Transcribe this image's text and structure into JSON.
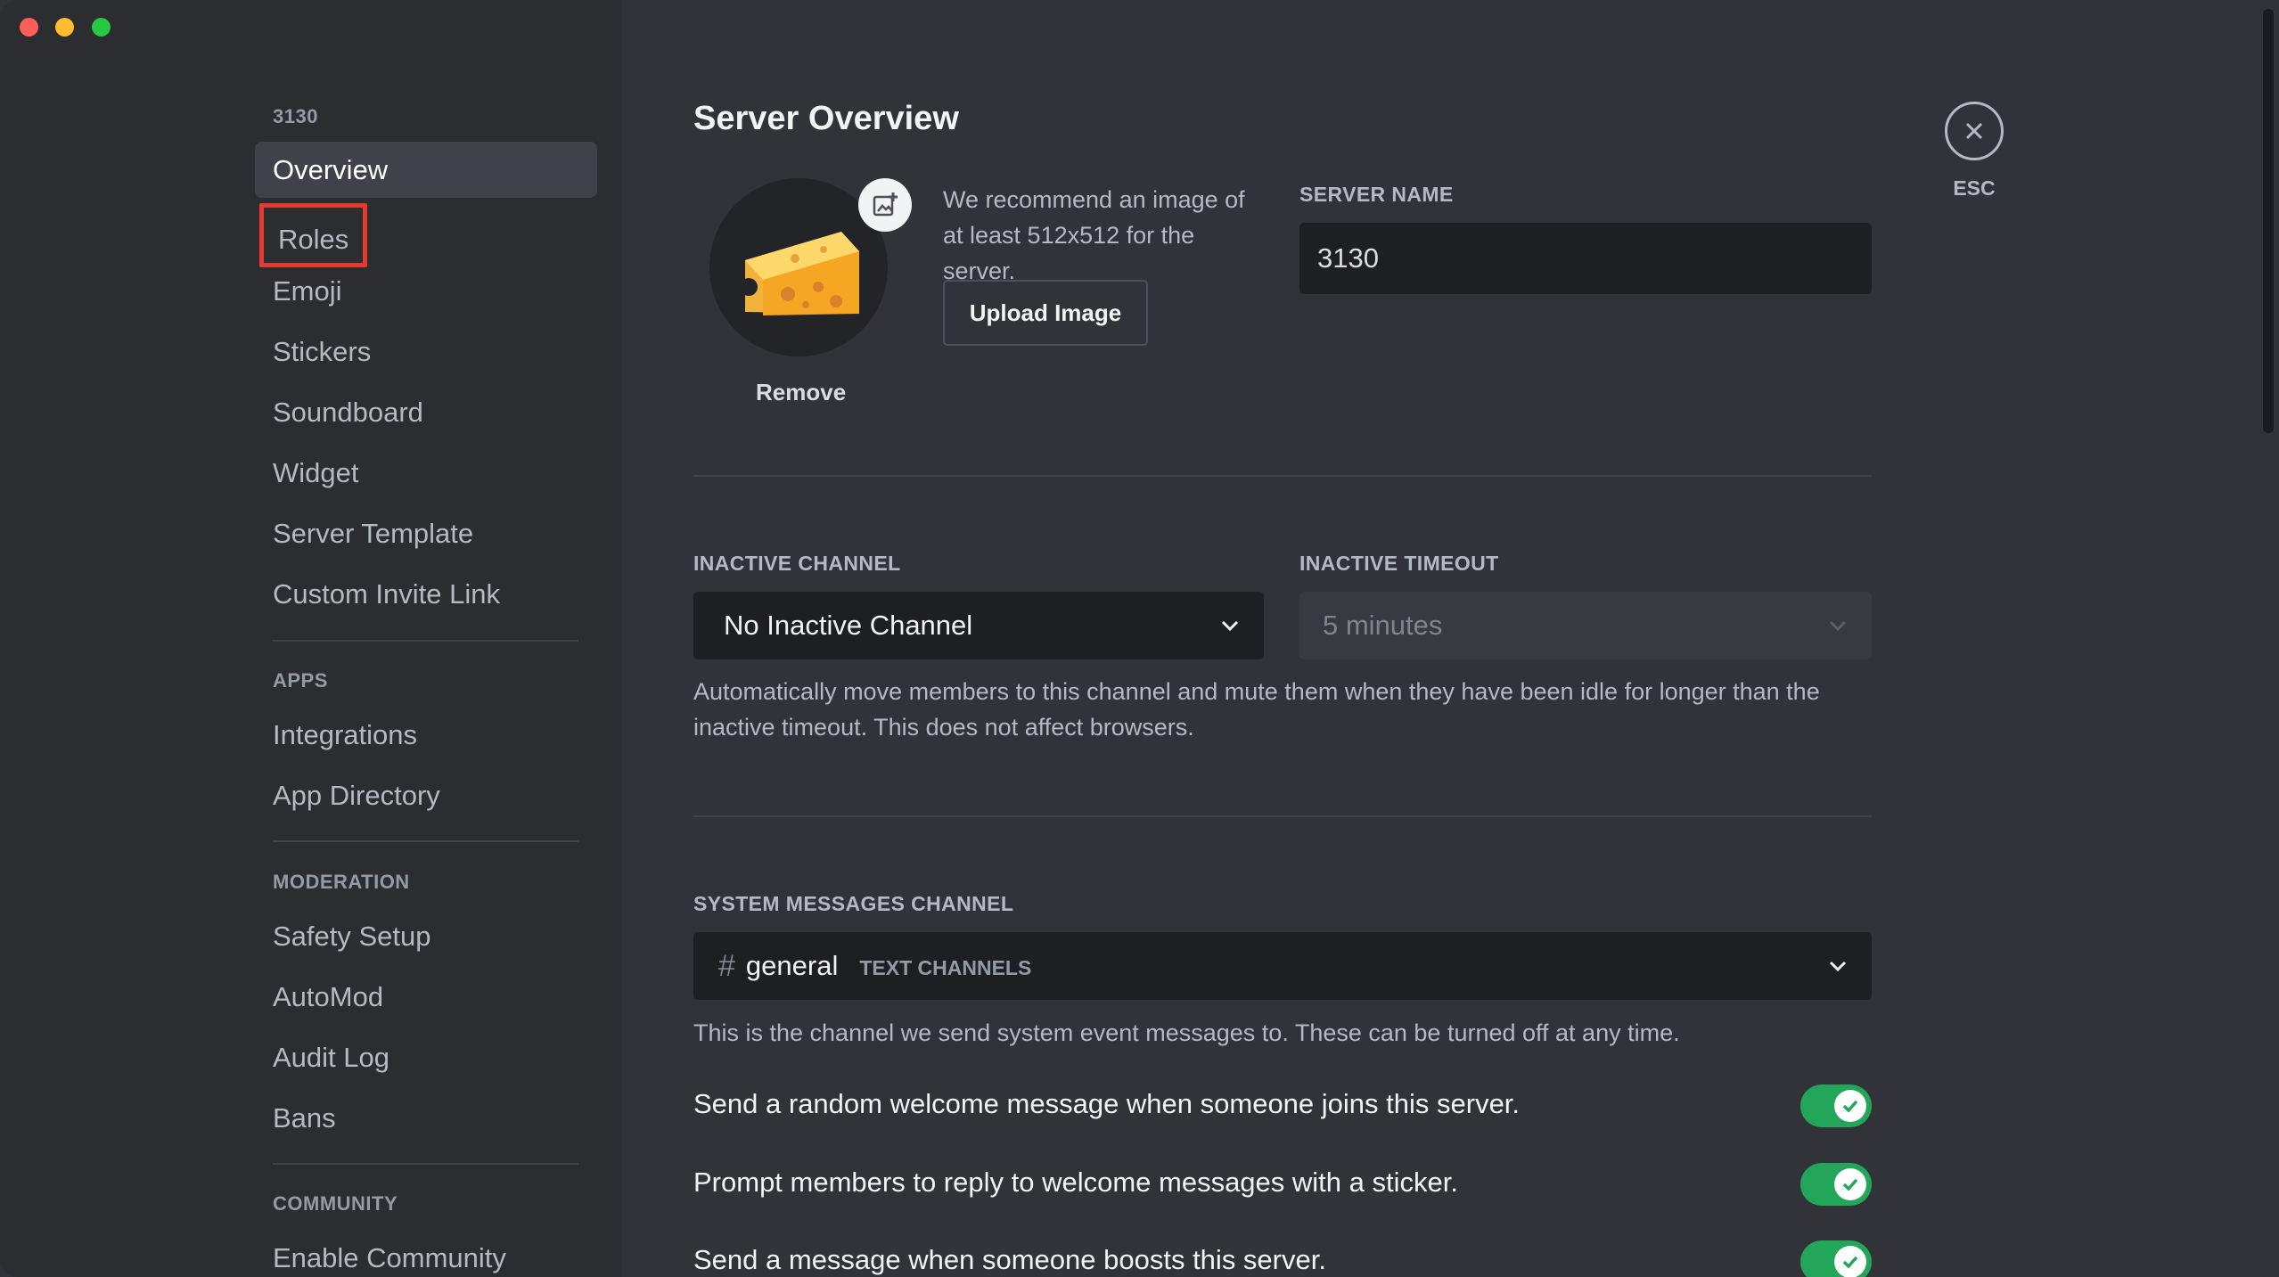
{
  "window": {
    "controls": [
      "close",
      "minimize",
      "maximize"
    ]
  },
  "sidebar": {
    "server_header": "3130",
    "items_main": [
      {
        "label": "Overview",
        "active": true
      },
      {
        "label": "Roles",
        "highlighted": true
      },
      {
        "label": "Emoji"
      },
      {
        "label": "Stickers"
      },
      {
        "label": "Soundboard"
      },
      {
        "label": "Widget"
      },
      {
        "label": "Server Template"
      },
      {
        "label": "Custom Invite Link"
      }
    ],
    "apps_header": "Apps",
    "items_apps": [
      {
        "label": "Integrations"
      },
      {
        "label": "App Directory"
      }
    ],
    "moderation_header": "Moderation",
    "items_moderation": [
      {
        "label": "Safety Setup"
      },
      {
        "label": "AutoMod"
      },
      {
        "label": "Audit Log"
      },
      {
        "label": "Bans"
      }
    ],
    "community_header": "Community",
    "items_community": [
      {
        "label": "Enable Community"
      }
    ]
  },
  "main": {
    "title": "Server Overview",
    "server_icon": {
      "emoji": "cheese-wedge",
      "remove_label": "Remove"
    },
    "recommend_text": "We recommend an image of at least 512x512 for the server.",
    "upload_label": "Upload Image",
    "server_name": {
      "label": "Server Name",
      "value": "3130"
    },
    "inactive_channel": {
      "label": "Inactive Channel",
      "value": "No Inactive Channel"
    },
    "inactive_timeout": {
      "label": "Inactive Timeout",
      "value": "5 minutes"
    },
    "inactive_help": "Automatically move members to this channel and mute them when they have been idle for longer than the inactive timeout. This does not affect browsers.",
    "system_channel": {
      "label": "System Messages Channel",
      "hash": "#",
      "channel": "general",
      "category": "TEXT CHANNELS"
    },
    "system_help": "This is the channel we send system event messages to. These can be turned off at any time.",
    "toggles": [
      {
        "label": "Send a random welcome message when someone joins this server.",
        "on": true
      },
      {
        "label": "Prompt members to reply to welcome messages with a sticker.",
        "on": true
      },
      {
        "label": "Send a message when someone boosts this server.",
        "on": true
      }
    ],
    "close": {
      "label": "ESC"
    }
  },
  "colors": {
    "accent_toggle": "#23a55a",
    "highlight_box": "#e53a2f",
    "sidebar_bg": "#2b2d31",
    "main_bg": "#313338"
  }
}
